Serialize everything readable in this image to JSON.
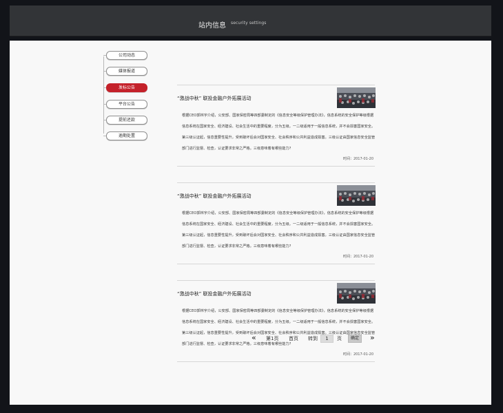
{
  "header": {
    "title": "站内信息",
    "subtitle": "security settings"
  },
  "sidebar": {
    "items": [
      {
        "label": "公司动态",
        "active": false
      },
      {
        "label": "媒体报道",
        "active": false
      },
      {
        "label": "发标公告",
        "active": true
      },
      {
        "label": "平台公告",
        "active": false
      },
      {
        "label": "提前还款",
        "active": false
      },
      {
        "label": "逾期处置",
        "active": false
      }
    ]
  },
  "articles": [
    {
      "title": "“激战中秋” 联投金融户外拓展活动",
      "body": "根据CEO郭林宇介绍，公安部、国家保密局等四部委制定的《信息安全等级保护管理办法》，信息系统的安全保护等级根据信息系统在国家安全、经济建设、社会生活中的重要程度，分为五级。一二级适用于一般信息系统，并不会损害国家安全。第三级认证起，信息重要性提升，受到破坏后会对国家安全、社会秩序和公共利益造成损害。三级认证由国家信息安全监管部门进行监督、检查，认证要求非常之严格。三级意味着有哪些能力?",
      "time": "时间：2017-01-20"
    },
    {
      "title": "“激战中秋” 联投金融户外拓展活动",
      "body": "根据CEO郭林宇介绍，公安部、国家保密局等四部委制定的《信息安全等级保护管理办法》，信息系统的安全保护等级根据信息系统在国家安全、经济建设、社会生活中的重要程度，分为五级。一二级适用于一般信息系统，并不会损害国家安全。第三级认证起，信息重要性提升，受到破坏后会对国家安全、社会秩序和公共利益造成损害。三级认证由国家信息安全监管部门进行监督、检查，认证要求非常之严格。三级意味着有哪些能力?",
      "time": "时间：2017-01-20"
    },
    {
      "title": "“激战中秋” 联投金融户外拓展活动",
      "body": "根据CEO郭林宇介绍，公安部、国家保密局等四部委制定的《信息安全等级保护管理办法》，信息系统的安全保护等级根据信息系统在国家安全、经济建设、社会生活中的重要程度，分为五级。一二级适用于一般信息系统，并不会损害国家安全。第三级认证起，信息重要性提升，受到破坏后会对国家安全、社会秩序和公共利益造成损害。三级认证由国家信息安全监管部门进行监督、检查，认证要求非常之严格。三级意味着有哪些能力?",
      "time": "时间：2017-01-20"
    }
  ],
  "pagination": {
    "prev_icon": "«",
    "next_icon": "»",
    "current_page": "第1页",
    "first_page": "首页",
    "goto_label": "转到",
    "goto_value": "1",
    "page_unit": "页",
    "confirm_label": "确定"
  },
  "colors": {
    "accent": "#c4212a",
    "header_bg": "#323437",
    "page_bg": "#f8f8f8"
  }
}
